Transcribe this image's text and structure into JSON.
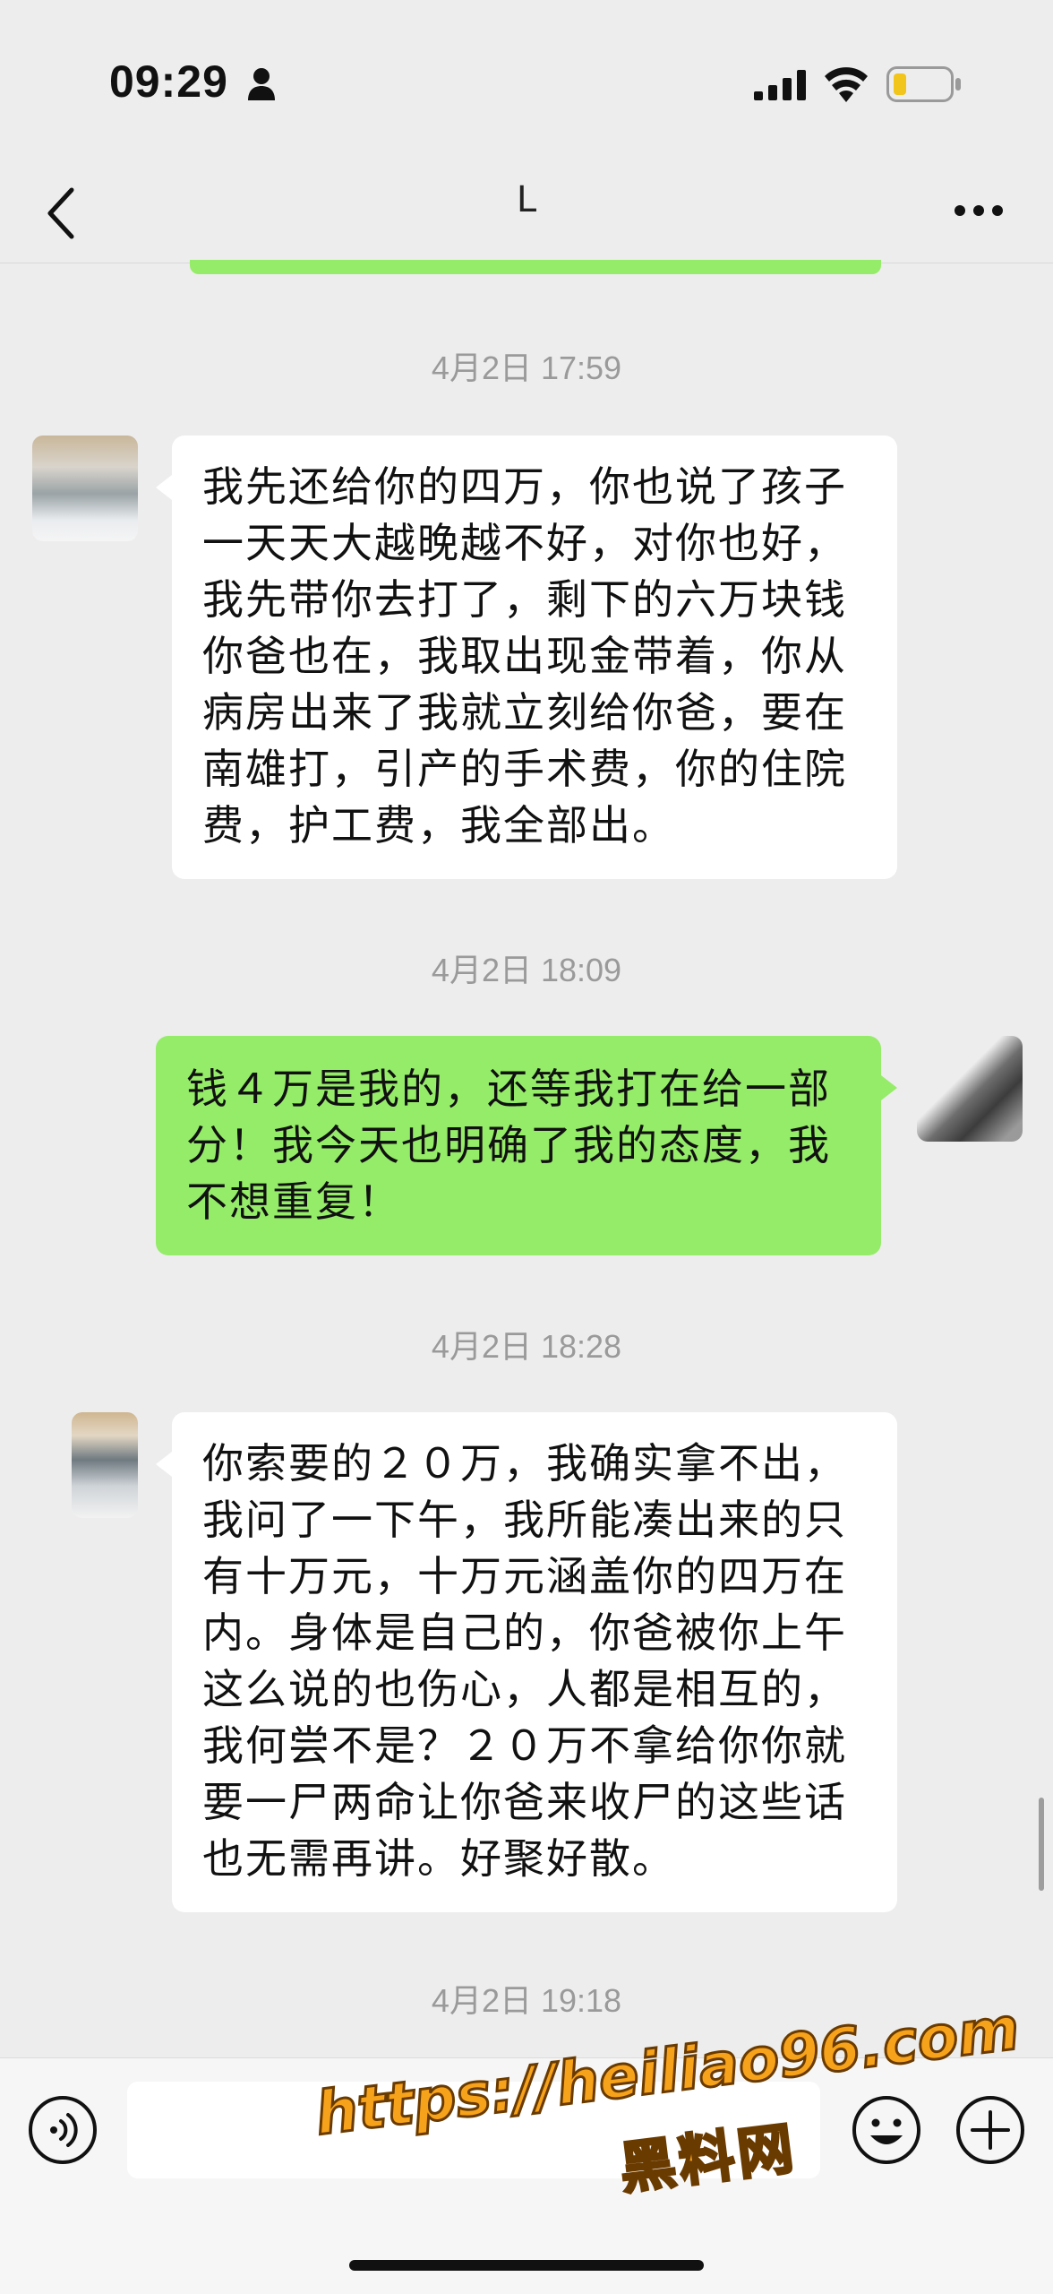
{
  "status_bar": {
    "time": "09:29",
    "icons": [
      "person-icon",
      "signal-icon",
      "wifi-icon",
      "battery-icon"
    ]
  },
  "nav": {
    "title": "L",
    "icons": [
      "back-icon",
      "more-icon"
    ]
  },
  "messages": [
    {
      "timestamp": "4月2日 17:59",
      "direction": "incoming",
      "text": "我先还给你的四万，你也说了孩子\n一天天大越晚越不好，对你也好，\n我先带你去打了，剩下的六万块钱\n你爸也在，我取出现金带着，你从\n病房出来了我就立刻给你爸，要在\n南雄打，引产的手术费，你的住院\n费，护工费，我全部出。"
    },
    {
      "timestamp": "4月2日 18:09",
      "direction": "outgoing",
      "text": "钱４万是我的，还等我打在给一部\n分！我今天也明确了我的态度，我\n不想重复！"
    },
    {
      "timestamp": "4月2日 18:28",
      "direction": "incoming",
      "text": "你索要的２０万，我确实拿不出，\n我问了一下午，我所能凑出来的只\n有十万元，十万元涵盖你的四万在\n内。身体是自己的，你爸被你上午\n这么说的也伤心，人都是相互的，\n我何尝不是？２０万不拿给你你就\n要一尸两命让你爸来收尸的这些话\n也无需再讲。好聚好散。"
    },
    {
      "timestamp": "4月2日 19:18"
    }
  ],
  "input_bar": {
    "value": "",
    "icons": [
      "voice-icon",
      "emoji-icon",
      "add-icon"
    ]
  },
  "watermark": {
    "url": "https://heiliao96.com",
    "name": "黑料网"
  },
  "colors": {
    "background": "#ededed",
    "incoming_bubble": "#ffffff",
    "outgoing_bubble": "#95ec69",
    "timestamp": "#9a9a9a",
    "watermark": "#f7a21b"
  }
}
